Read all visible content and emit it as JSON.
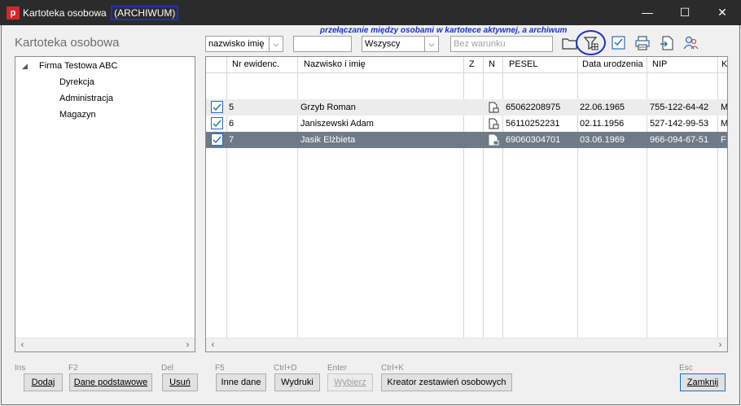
{
  "window": {
    "title": "Kartoteka osobowa",
    "title_suffix": "(ARCHIWUM)",
    "minimize": "—",
    "maximize": "☐",
    "close": "✕"
  },
  "app_icon_letter": "p",
  "section_title": "Kartoteka osobowa",
  "annotation": "przełączanie między osobami w kartotece aktywnej, a archiwum",
  "filters": {
    "sort_combo": "nazwisko imię",
    "search_value": "",
    "group_combo": "Wszyscy",
    "condition_placeholder": "Bez warunku"
  },
  "toolbar_icons": [
    "folder-icon",
    "archive-filter-icon",
    "check-icon",
    "print-icon",
    "export-icon",
    "users-icon"
  ],
  "tree": {
    "root": "Firma Testowa ABC",
    "children": [
      "Dyrekcja",
      "Administracja",
      "Magazyn"
    ]
  },
  "grid": {
    "headers": [
      "Nr ewidenc.",
      "Nazwisko i imię",
      "Z",
      "N",
      "PESEL",
      "Data urodzenia",
      "NIP",
      "K"
    ],
    "rows": [
      {
        "nr": "5",
        "name": "Grzyb Roman",
        "pesel": "65062208975",
        "birth": "22.06.1965",
        "nip": "755-122-64-42",
        "k": "M"
      },
      {
        "nr": "6",
        "name": "Janiszewski Adam",
        "pesel": "56110252231",
        "birth": "02.11.1956",
        "nip": "527-142-99-53",
        "k": "M"
      },
      {
        "nr": "7",
        "name": "Jasik Elżbieta",
        "pesel": "69060304701",
        "birth": "03.06.1969",
        "nip": "966-094-67-51",
        "k": "F"
      }
    ]
  },
  "buttons": [
    {
      "hint": "Ins",
      "label": "Dodaj"
    },
    {
      "hint": "F2",
      "label": "Dane podstawowe"
    },
    {
      "hint": "Del",
      "label": "Usuń"
    },
    {
      "hint": "F5",
      "label": "Inne dane"
    },
    {
      "hint": "Ctrl+D",
      "label": "Wydruki"
    },
    {
      "hint": "Enter",
      "label": "Wybierz"
    },
    {
      "hint": "Ctrl+K",
      "label": "Kreator zestawień osobowych"
    },
    {
      "hint": "Esc",
      "label": "Zamknij"
    }
  ],
  "colors": {
    "titlebar": "#2b2b2b",
    "annotation": "#1a33c8",
    "selected_row": "#6e7a86",
    "app_icon": "#d9262c"
  }
}
